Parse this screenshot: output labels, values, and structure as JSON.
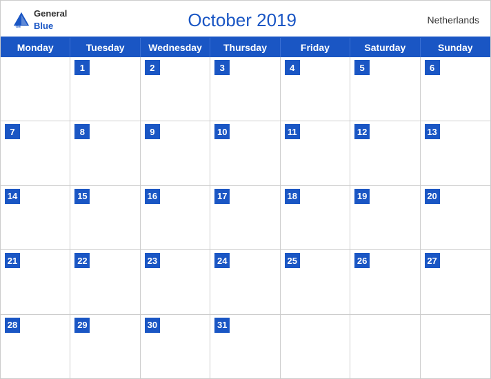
{
  "header": {
    "logo_general": "General",
    "logo_blue": "Blue",
    "title": "October 2019",
    "country": "Netherlands"
  },
  "weekdays": [
    "Monday",
    "Tuesday",
    "Wednesday",
    "Thursday",
    "Friday",
    "Saturday",
    "Sunday"
  ],
  "weeks": [
    [
      {
        "num": "",
        "empty": true
      },
      {
        "num": "1"
      },
      {
        "num": "2"
      },
      {
        "num": "3"
      },
      {
        "num": "4"
      },
      {
        "num": "5"
      },
      {
        "num": "6"
      }
    ],
    [
      {
        "num": "7"
      },
      {
        "num": "8"
      },
      {
        "num": "9"
      },
      {
        "num": "10"
      },
      {
        "num": "11"
      },
      {
        "num": "12"
      },
      {
        "num": "13"
      }
    ],
    [
      {
        "num": "14"
      },
      {
        "num": "15"
      },
      {
        "num": "16"
      },
      {
        "num": "17"
      },
      {
        "num": "18"
      },
      {
        "num": "19"
      },
      {
        "num": "20"
      }
    ],
    [
      {
        "num": "21"
      },
      {
        "num": "22"
      },
      {
        "num": "23"
      },
      {
        "num": "24"
      },
      {
        "num": "25"
      },
      {
        "num": "26"
      },
      {
        "num": "27"
      }
    ],
    [
      {
        "num": "28"
      },
      {
        "num": "29"
      },
      {
        "num": "30"
      },
      {
        "num": "31"
      },
      {
        "num": ""
      },
      {
        "num": ""
      },
      {
        "num": ""
      }
    ]
  ],
  "colors": {
    "blue": "#1a56c4",
    "dark_blue": "#1a3a8c"
  }
}
